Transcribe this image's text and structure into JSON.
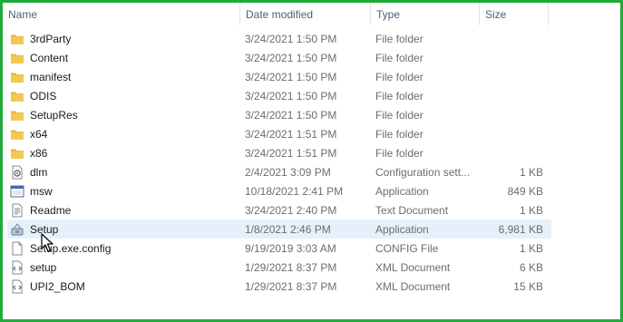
{
  "header": {
    "name": "Name",
    "date_modified": "Date modified",
    "type": "Type",
    "size": "Size"
  },
  "files": [
    {
      "name": "3rdParty",
      "date": "3/24/2021 1:50 PM",
      "type": "File folder",
      "size": "",
      "icon": "folder-icon"
    },
    {
      "name": "Content",
      "date": "3/24/2021 1:50 PM",
      "type": "File folder",
      "size": "",
      "icon": "folder-icon"
    },
    {
      "name": "manifest",
      "date": "3/24/2021 1:50 PM",
      "type": "File folder",
      "size": "",
      "icon": "folder-icon"
    },
    {
      "name": "ODIS",
      "date": "3/24/2021 1:50 PM",
      "type": "File folder",
      "size": "",
      "icon": "folder-icon"
    },
    {
      "name": "SetupRes",
      "date": "3/24/2021 1:50 PM",
      "type": "File folder",
      "size": "",
      "icon": "folder-icon"
    },
    {
      "name": "x64",
      "date": "3/24/2021 1:51 PM",
      "type": "File folder",
      "size": "",
      "icon": "folder-icon"
    },
    {
      "name": "x86",
      "date": "3/24/2021 1:51 PM",
      "type": "File folder",
      "size": "",
      "icon": "folder-icon"
    },
    {
      "name": "dlm",
      "date": "2/4/2021 3:09 PM",
      "type": "Configuration sett...",
      "size": "1 KB",
      "icon": "config-file-icon"
    },
    {
      "name": "msw",
      "date": "10/18/2021 2:41 PM",
      "type": "Application",
      "size": "849 KB",
      "icon": "application-icon"
    },
    {
      "name": "Readme",
      "date": "3/24/2021 2:40 PM",
      "type": "Text Document",
      "size": "1 KB",
      "icon": "text-document-icon"
    },
    {
      "name": "Setup",
      "date": "1/8/2021 2:46 PM",
      "type": "Application",
      "size": "6,981 KB",
      "icon": "setup-application-icon",
      "selected": true
    },
    {
      "name": "Setup.exe.config",
      "date": "9/19/2019 3:03 AM",
      "type": "CONFIG File",
      "size": "1 KB",
      "icon": "blank-file-icon"
    },
    {
      "name": "setup",
      "date": "1/29/2021 8:37 PM",
      "type": "XML Document",
      "size": "6 KB",
      "icon": "xml-document-icon"
    },
    {
      "name": "UPI2_BOM",
      "date": "1/29/2021 8:37 PM",
      "type": "XML Document",
      "size": "15 KB",
      "icon": "xml-document-icon"
    }
  ],
  "colors": {
    "frame_border": "#1faa3a",
    "header_text": "#4c607a",
    "selected_row": "#e5f0fb",
    "folder": "#f4c851"
  }
}
